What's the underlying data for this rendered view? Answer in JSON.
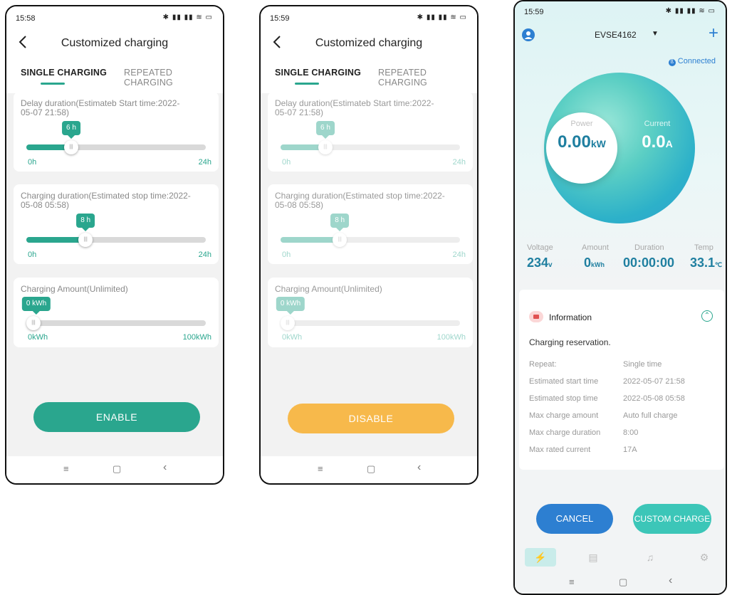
{
  "colors": {
    "accent": "#2aa68e",
    "disable": "#f7b94b",
    "cancel": "#2d7fd1",
    "custom": "#3cc6b8"
  },
  "screen1": {
    "status_time": "15:58",
    "title": "Customized charging",
    "tabs": [
      "SINGLE CHARGING",
      "REPEATED CHARGING"
    ],
    "sliders": [
      {
        "label": "Delay duration(Estimateb Start time:2022-05-07 21:58)",
        "value_label": "6 h",
        "value_fraction": 0.25,
        "min": "0h",
        "max": "24h"
      },
      {
        "label": "Charging duration(Estimated stop time:2022-05-08 05:58)",
        "value_label": "8 h",
        "value_fraction": 0.33,
        "min": "0h",
        "max": "24h"
      },
      {
        "label": "Charging Amount(Unlimited)",
        "value_label": "0 kWh",
        "value_fraction": 0.0,
        "min": "0kWh",
        "max": "100kWh"
      }
    ],
    "button": "ENABLE"
  },
  "screen2": {
    "status_time": "15:59",
    "title": "Customized charging",
    "tabs": [
      "SINGLE CHARGING",
      "REPEATED CHARGING"
    ],
    "sliders": [
      {
        "label": "Delay duration(Estimateb Start time:2022-05-07 21:58)",
        "value_label": "6 h",
        "value_fraction": 0.25,
        "min": "0h",
        "max": "24h"
      },
      {
        "label": "Charging duration(Estimated stop time:2022-05-08 05:58)",
        "value_label": "8 h",
        "value_fraction": 0.33,
        "min": "0h",
        "max": "24h"
      },
      {
        "label": "Charging Amount(Unlimited)",
        "value_label": "0 kWh",
        "value_fraction": 0.0,
        "min": "0kWh",
        "max": "100kWh"
      }
    ],
    "button": "DISABLE"
  },
  "screen3": {
    "status_time": "15:59",
    "device": "EVSE4162",
    "connection": "Connected",
    "power": {
      "label": "Power",
      "value": "0.00",
      "unit": "kW"
    },
    "current": {
      "label": "Current",
      "value": "0.0",
      "unit": "A"
    },
    "stats": [
      {
        "label": "Voltage",
        "value": "234",
        "unit": "v"
      },
      {
        "label": "Amount",
        "value": "0",
        "unit": "kWh"
      },
      {
        "label": "Duration",
        "value": "00:00:00",
        "unit": ""
      },
      {
        "label": "Temp",
        "value": "33.1",
        "unit": "℃"
      }
    ],
    "info_title": "Information",
    "info_subtitle": "Charging reservation.",
    "info_rows": [
      {
        "k": "Repeat:",
        "v": "Single time"
      },
      {
        "k": "Estimated start time",
        "v": "2022-05-07 21:58"
      },
      {
        "k": "Estimated stop time",
        "v": "2022-05-08 05:58"
      },
      {
        "k": "Max charge amount",
        "v": "Auto full charge"
      },
      {
        "k": "Max charge duration",
        "v": "8:00"
      },
      {
        "k": "Max rated current",
        "v": "17A"
      }
    ],
    "cancel": "CANCEL",
    "custom": "CUSTOM CHARGE"
  },
  "navbar": {
    "menu": "≡",
    "home": "▢",
    "back": "‹"
  }
}
